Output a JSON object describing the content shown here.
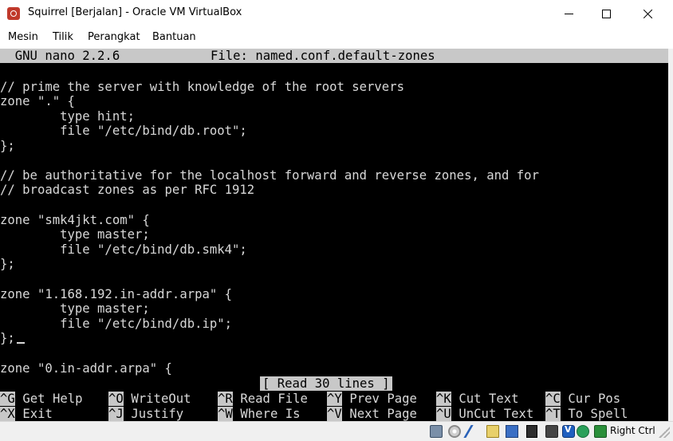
{
  "window": {
    "title": "Squirrel [Berjalan] - Oracle VM VirtualBox",
    "icon": "virtualbox-icon",
    "controls": [
      "minimize-icon",
      "maximize-icon",
      "close-icon"
    ]
  },
  "menu": {
    "items": [
      {
        "label": "Mesin"
      },
      {
        "label": "Tilik"
      },
      {
        "label": "Perangkat"
      },
      {
        "label": "Bantuan"
      }
    ]
  },
  "nano": {
    "version": "  GNU nano 2.2.6",
    "file": "File: named.conf.default-zones",
    "lines": [
      "// prime the server with knowledge of the root servers",
      "zone \".\" {",
      "        type hint;",
      "        file \"/etc/bind/db.root\";",
      "};",
      "",
      "// be authoritative for the localhost forward and reverse zones, and for",
      "// broadcast zones as per RFC 1912",
      "",
      "zone \"smk4jkt.com\" {",
      "        type master;",
      "        file \"/etc/bind/db.smk4\";",
      "};",
      "",
      "zone \"1.168.192.in-addr.arpa\" {",
      "        type master;",
      "        file \"/etc/bind/db.ip\";",
      "};",
      "",
      "zone \"0.in-addr.arpa\" {"
    ],
    "status": "[ Read 30 lines ]",
    "shortcuts_row1": [
      {
        "key": "^G",
        "label": " Get Help  "
      },
      {
        "key": "^O",
        "label": " WriteOut  "
      },
      {
        "key": "^R",
        "label": " Read File "
      },
      {
        "key": "^Y",
        "label": " Prev Page "
      },
      {
        "key": "^K",
        "label": " Cut Text  "
      },
      {
        "key": "^C",
        "label": " Cur Pos"
      }
    ],
    "shortcuts_row2": [
      {
        "key": "^X",
        "label": " Exit      "
      },
      {
        "key": "^J",
        "label": " Justify   "
      },
      {
        "key": "^W",
        "label": " Where Is  "
      },
      {
        "key": "^V",
        "label": " Next Page "
      },
      {
        "key": "^U",
        "label": " UnCut Text"
      },
      {
        "key": "^T",
        "label": " To Spell"
      }
    ]
  },
  "statusbar": {
    "host_key": "Right Ctrl",
    "icons": [
      "hard-disk-icon",
      "optical-drive-icon",
      "usb-icon",
      "shared-folder-icon",
      "display-icon",
      "network-icon",
      "recording-icon",
      "vt-x-icon",
      "mouse-integration-icon",
      "keyboard-capture-icon"
    ]
  },
  "colors": {
    "terminal_bg": "#000000",
    "terminal_fg": "#d8d8d8",
    "inverse_bg": "#c8c8c8"
  }
}
